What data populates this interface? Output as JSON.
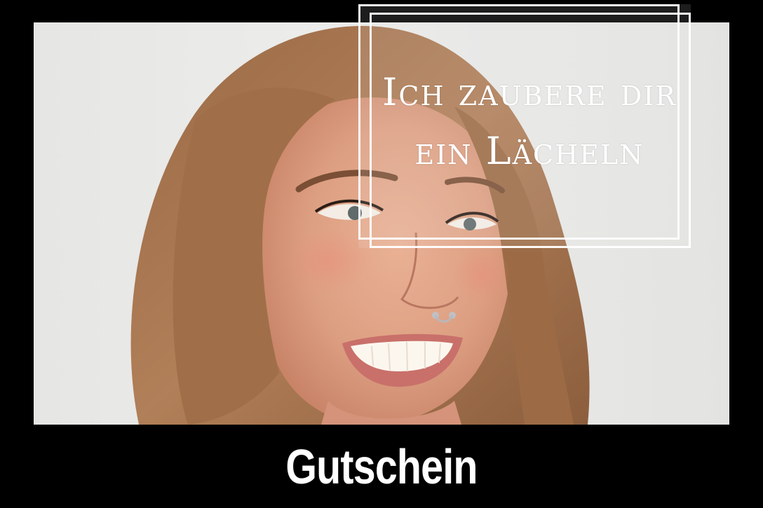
{
  "voucher": {
    "tagline_line1": "Ich zaubere dir",
    "tagline_line2": "ein Lächeln",
    "title": "Gutschein"
  },
  "colors": {
    "background": "#000000",
    "text": "#ffffff",
    "wall": "#e8e8e6",
    "hair": "#a7754f",
    "skin": "#e0a384"
  },
  "photo": {
    "subject": "smiling woman with long light-brown hair and nose ring, looking to the right"
  }
}
